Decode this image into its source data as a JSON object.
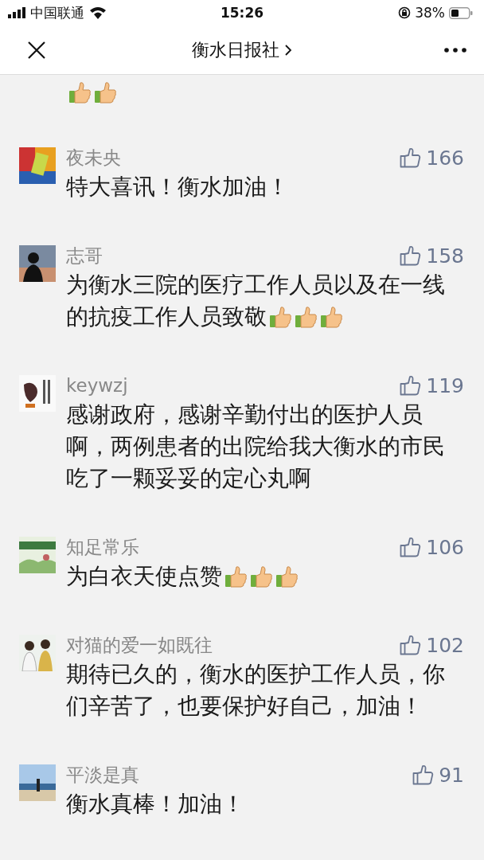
{
  "status_bar": {
    "carrier": "中国联通",
    "time": "15:26",
    "battery": "38%"
  },
  "nav": {
    "title": "衡水日报社"
  },
  "partial_comment": {
    "emojis": [
      {
        "kind": "thumbs-up"
      },
      {
        "kind": "thumbs-up"
      }
    ]
  },
  "comments": [
    {
      "name": "夜未央",
      "likes": "166",
      "lines": [
        "特大喜讯！衡水加油！"
      ]
    },
    {
      "name": "志哥",
      "likes": "158",
      "lines": [
        "为衡水三院的医疗工作人员以及在一线",
        "的抗疫工作人员致敬"
      ],
      "emojis": [
        {
          "kind": "thumbs-up"
        },
        {
          "kind": "thumbs-up"
        },
        {
          "kind": "thumbs-up"
        }
      ]
    },
    {
      "name": "keywzj",
      "likes": "119",
      "lines": [
        "感谢政府，感谢辛勤付出的医护人员",
        "啊，两例患者的出院给我大衡水的市民",
        "吃了一颗妥妥的定心丸啊"
      ]
    },
    {
      "name": "知足常乐",
      "likes": "106",
      "lines": [
        "为白衣天使点赞"
      ],
      "emojis": [
        {
          "kind": "thumbs-up"
        },
        {
          "kind": "thumbs-up"
        },
        {
          "kind": "thumbs-up"
        }
      ]
    },
    {
      "name": "对猫的爱一如既往",
      "likes": "102",
      "lines": [
        "期待已久的，衡水的医护工作人员，你",
        "们辛苦了，也要保护好自己，加油！"
      ]
    },
    {
      "name": "平淡是真",
      "likes": "91",
      "lines": [
        "衡水真棒！加油！"
      ]
    }
  ]
}
